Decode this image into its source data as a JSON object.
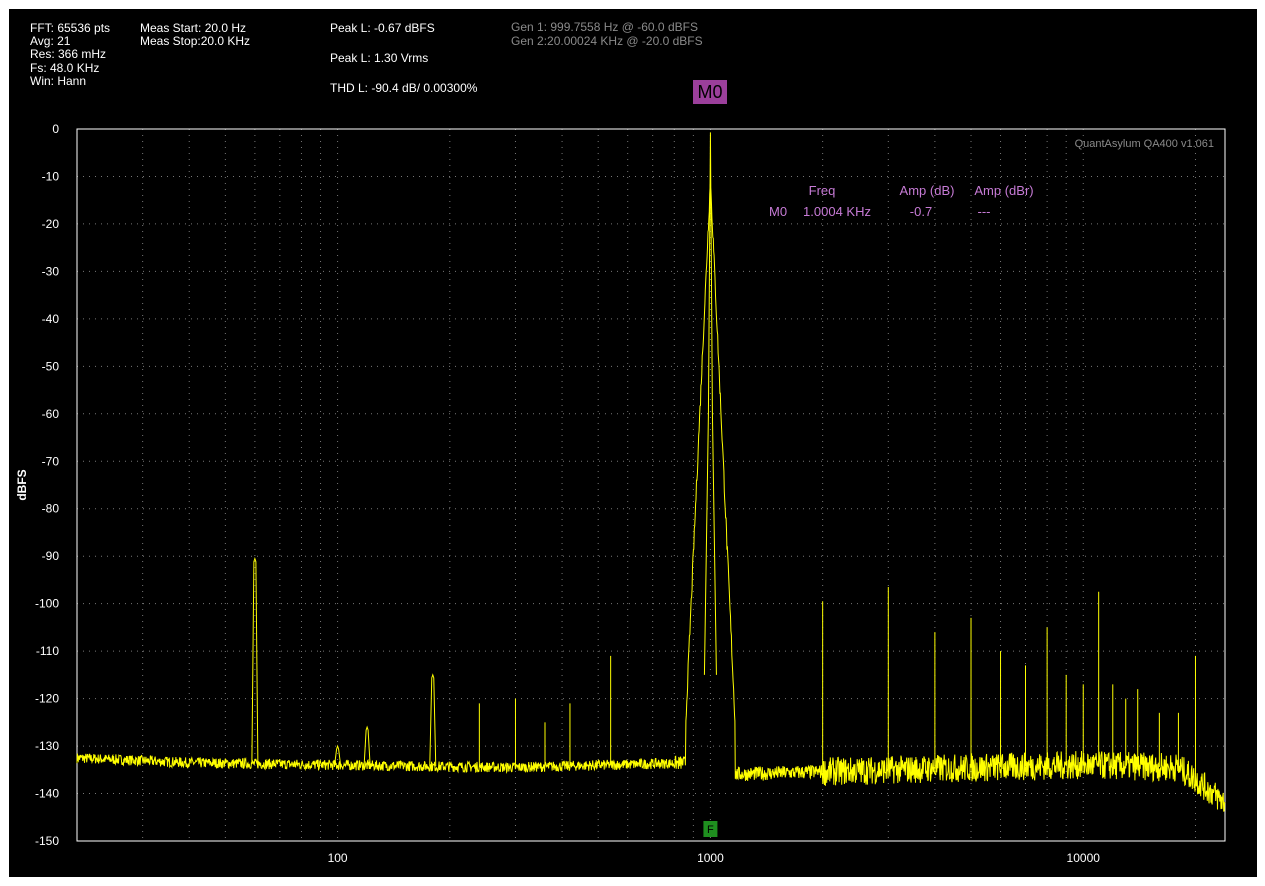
{
  "header": {
    "col1": [
      "FFT: 65536 pts",
      "Avg: 21",
      "Res: 366 mHz",
      "Fs: 48.0 KHz",
      "Win: Hann"
    ],
    "col2": [
      "Meas Start: 20.0 Hz",
      "Meas Stop:20.0 KHz"
    ],
    "col3": [
      "Peak L: -0.67 dBFS",
      "Peak L: 1.30 Vrms",
      "THD L: -90.4 dB/ 0.00300%"
    ],
    "gen": [
      "Gen 1: 999.7558 Hz @ -60.0  dBFS",
      "Gen 2:20.00024 KHz @ -20.0  dBFS"
    ],
    "marker_badge": "M0"
  },
  "watermark": "QuantAsylum QA400 v1.061",
  "marker_table": {
    "headers": [
      "Freq",
      "Amp (dB)",
      "Amp (dBr)"
    ],
    "row": {
      "name": "M0",
      "freq": "1.0004 KHz",
      "amp": "-0.7",
      "ampr": "---"
    }
  },
  "fundamental_label": "F",
  "colors": {
    "trace": "#ffff00",
    "marker_badge": "#9b3f9b",
    "marker_text": "#c77bd6",
    "fundamental_box": "#1f8f1f",
    "background": "#000000",
    "grid": "#777777"
  },
  "chart_data": {
    "type": "line",
    "title": "",
    "xlabel": "",
    "ylabel": "dBFS",
    "x_scale": "log",
    "xlim": [
      20,
      24000
    ],
    "ylim": [
      -150,
      0
    ],
    "x_ticks": [
      "100",
      "1000",
      "10000"
    ],
    "y_ticks": [
      "0",
      "-10",
      "-20",
      "-30",
      "-40",
      "-50",
      "-60",
      "-70",
      "-80",
      "-90",
      "-100",
      "-110",
      "-120",
      "-130",
      "-140",
      "-150"
    ],
    "grid": true,
    "noise_floor": [
      [
        20,
        -132.5
      ],
      [
        40,
        -133.5
      ],
      [
        100,
        -134
      ],
      [
        300,
        -134.5
      ],
      [
        900,
        -133.5
      ],
      [
        1100,
        -136
      ],
      [
        3000,
        -135
      ],
      [
        10000,
        -134
      ],
      [
        18000,
        -134.5
      ],
      [
        20000,
        -137
      ],
      [
        24000,
        -142
      ]
    ],
    "peaks": [
      {
        "x": 60,
        "y": -90.5
      },
      {
        "x": 100,
        "y": -130
      },
      {
        "x": 120,
        "y": -126
      },
      {
        "x": 180,
        "y": -115
      },
      {
        "x": 240,
        "y": -121
      },
      {
        "x": 300,
        "y": -120
      },
      {
        "x": 360,
        "y": -125
      },
      {
        "x": 420,
        "y": -121
      },
      {
        "x": 540,
        "y": -111
      },
      {
        "x": 1000,
        "y": -0.7
      },
      {
        "x": 2000,
        "y": -99.5
      },
      {
        "x": 3000,
        "y": -96.5
      },
      {
        "x": 4000,
        "y": -106
      },
      {
        "x": 5000,
        "y": -103
      },
      {
        "x": 6000,
        "y": -110
      },
      {
        "x": 7000,
        "y": -113
      },
      {
        "x": 8000,
        "y": -105
      },
      {
        "x": 9000,
        "y": -115
      },
      {
        "x": 10000,
        "y": -117
      },
      {
        "x": 11000,
        "y": -97.5
      },
      {
        "x": 12000,
        "y": -117
      },
      {
        "x": 13000,
        "y": -120
      },
      {
        "x": 14000,
        "y": -118
      },
      {
        "x": 16000,
        "y": -123
      },
      {
        "x": 18000,
        "y": -123
      },
      {
        "x": 20000,
        "y": -111
      }
    ],
    "fundamental_hz": 1000
  }
}
